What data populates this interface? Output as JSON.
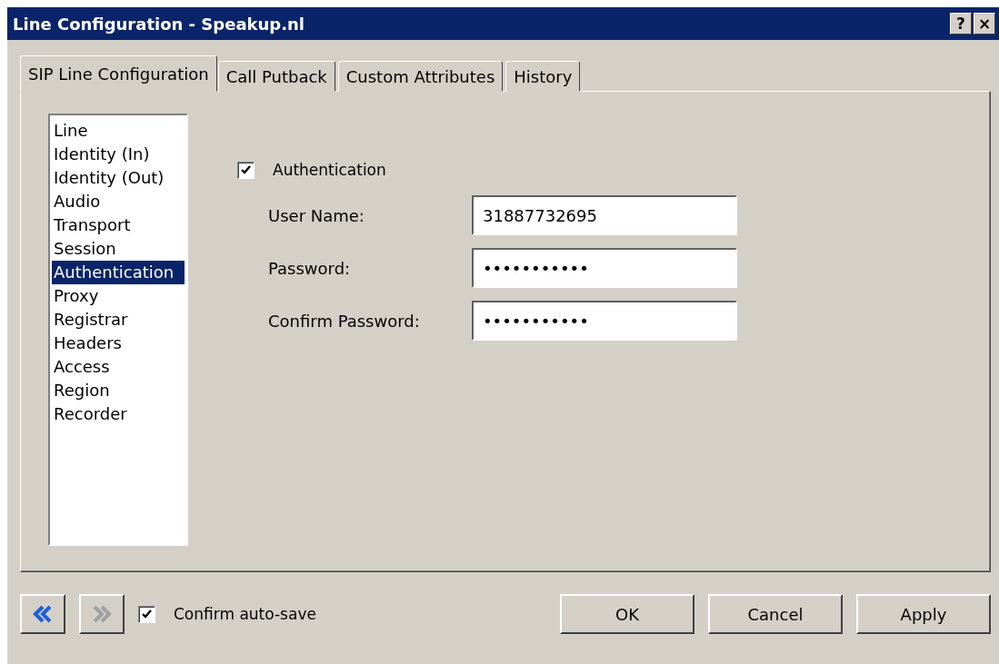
{
  "window": {
    "title": "Line Configuration - Speakup.nl",
    "help_button": "?",
    "close_button": "×"
  },
  "tabs": [
    {
      "label": "SIP Line Configuration",
      "selected": true
    },
    {
      "label": "Call Putback",
      "selected": false
    },
    {
      "label": "Custom Attributes",
      "selected": false
    },
    {
      "label": "History",
      "selected": false
    }
  ],
  "sections": [
    {
      "label": "Line",
      "selected": false
    },
    {
      "label": "Identity (In)",
      "selected": false
    },
    {
      "label": "Identity (Out)",
      "selected": false
    },
    {
      "label": "Audio",
      "selected": false
    },
    {
      "label": "Transport",
      "selected": false
    },
    {
      "label": "Session",
      "selected": false
    },
    {
      "label": "Authentication",
      "selected": true
    },
    {
      "label": "Proxy",
      "selected": false
    },
    {
      "label": "Registrar",
      "selected": false
    },
    {
      "label": "Headers",
      "selected": false
    },
    {
      "label": "Access",
      "selected": false
    },
    {
      "label": "Region",
      "selected": false
    },
    {
      "label": "Recorder",
      "selected": false
    }
  ],
  "authentication": {
    "label": "Authentication",
    "checked": true
  },
  "fields": [
    {
      "label": "User Name:",
      "value": "31887732695"
    },
    {
      "label": "Password:",
      "value": "•••••••••••"
    },
    {
      "label": "Confirm Password:",
      "value": "•••••••••••"
    }
  ],
  "nav": {
    "back_disabled": false,
    "forward_disabled": true
  },
  "confirm_autosave": {
    "label": "Confirm auto-save",
    "checked": true
  },
  "buttons": [
    "OK",
    "Cancel",
    "Apply"
  ]
}
